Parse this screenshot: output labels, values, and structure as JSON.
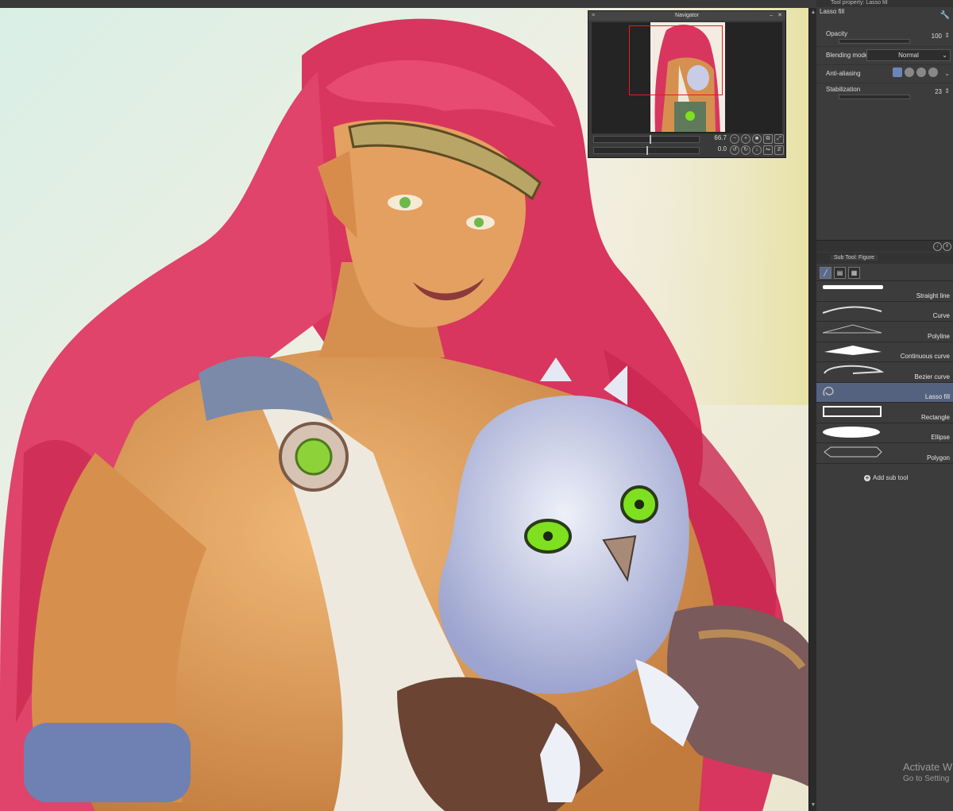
{
  "navigator": {
    "title": "Navigator",
    "zoom_value": "66.7",
    "rotate_value": "0.0"
  },
  "tool_property": {
    "tab_label": "Tool property: Lasso fill",
    "tool_name": "Lasso fill",
    "opacity_label": "Opacity",
    "opacity_value": "100",
    "blending_label": "Blending mode",
    "blending_value": "Normal",
    "antialias_label": "Anti-aliasing",
    "stabilization_label": "Stabilization",
    "stabilization_value": "23"
  },
  "sub_tool": {
    "tab_label": "Sub Tool: Figure",
    "items": [
      {
        "label": "Straight line",
        "icon": "straight-line-icon"
      },
      {
        "label": "Curve",
        "icon": "curve-icon"
      },
      {
        "label": "Polyline",
        "icon": "polyline-icon"
      },
      {
        "label": "Continuous curve",
        "icon": "continuous-curve-icon"
      },
      {
        "label": "Bezier curve",
        "icon": "bezier-curve-icon"
      },
      {
        "label": "Lasso fill",
        "icon": "lasso-fill-icon",
        "selected": true
      },
      {
        "label": "Rectangle",
        "icon": "rectangle-icon"
      },
      {
        "label": "Ellipse",
        "icon": "ellipse-icon"
      },
      {
        "label": "Polygon",
        "icon": "polygon-icon"
      }
    ],
    "add_label": "Add sub tool"
  },
  "watermark": {
    "line1": "Activate W",
    "line2": "Go to Setting"
  },
  "colors": {
    "panel_bg": "#3c3c3c",
    "selected_row": "#55627f",
    "nav_frame": "#e0201c"
  }
}
